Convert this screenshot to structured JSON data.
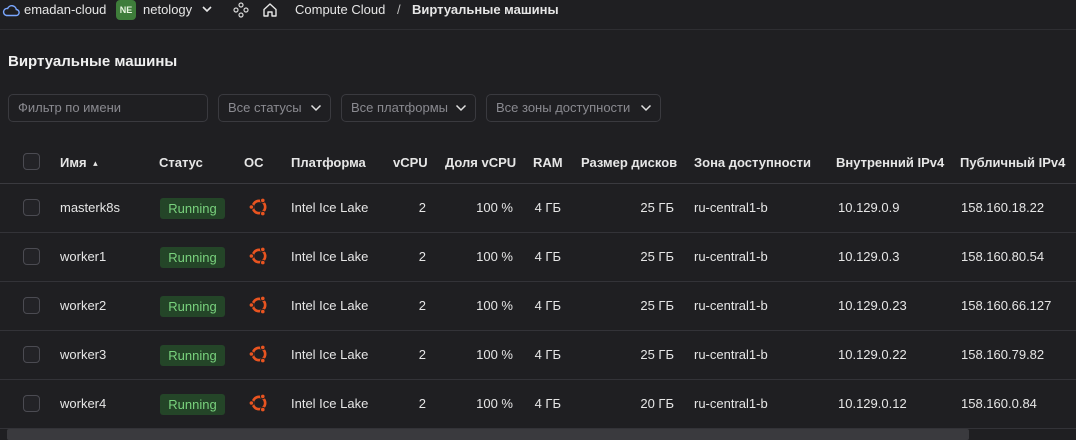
{
  "topbar": {
    "cloud_name": "emadan-cloud",
    "folder_badge": "NE",
    "folder_name": "netology",
    "breadcrumb_service": "Compute Cloud",
    "breadcrumb_separator": "/",
    "breadcrumb_current": "Виртуальные машины"
  },
  "page": {
    "title": "Виртуальные машины"
  },
  "filters": {
    "name_placeholder": "Фильтр по имени",
    "status": "Все статусы",
    "platform": "Все платформы",
    "zone": "Все зоны доступности"
  },
  "table": {
    "headers": {
      "name": "Имя",
      "sort_indicator": "▴",
      "status": "Статус",
      "os": "ОС",
      "platform": "Платформа",
      "vcpu": "vCPU",
      "vcpu_share": "Доля vCPU",
      "ram": "RAM",
      "disk": "Размер дисков",
      "zone": "Зона доступности",
      "ipv4_internal": "Внутренний IPv4",
      "ipv4_public": "Публичный IPv4"
    },
    "rows": [
      {
        "name": "masterk8s",
        "status": "Running",
        "os": "ubuntu-icon",
        "platform": "Intel Ice Lake",
        "vcpu": "2",
        "vcpu_share": "100 %",
        "ram": "4 ГБ",
        "disk": "25 ГБ",
        "zone": "ru-central1-b",
        "ipv4_internal": "10.129.0.9",
        "ipv4_public": "158.160.18.22"
      },
      {
        "name": "worker1",
        "status": "Running",
        "os": "ubuntu-icon",
        "platform": "Intel Ice Lake",
        "vcpu": "2",
        "vcpu_share": "100 %",
        "ram": "4 ГБ",
        "disk": "25 ГБ",
        "zone": "ru-central1-b",
        "ipv4_internal": "10.129.0.3",
        "ipv4_public": "158.160.80.54"
      },
      {
        "name": "worker2",
        "status": "Running",
        "os": "ubuntu-icon",
        "platform": "Intel Ice Lake",
        "vcpu": "2",
        "vcpu_share": "100 %",
        "ram": "4 ГБ",
        "disk": "25 ГБ",
        "zone": "ru-central1-b",
        "ipv4_internal": "10.129.0.23",
        "ipv4_public": "158.160.66.127"
      },
      {
        "name": "worker3",
        "status": "Running",
        "os": "ubuntu-icon",
        "platform": "Intel Ice Lake",
        "vcpu": "2",
        "vcpu_share": "100 %",
        "ram": "4 ГБ",
        "disk": "25 ГБ",
        "zone": "ru-central1-b",
        "ipv4_internal": "10.129.0.22",
        "ipv4_public": "158.160.79.82"
      },
      {
        "name": "worker4",
        "status": "Running",
        "os": "ubuntu-icon",
        "platform": "Intel Ice Lake",
        "vcpu": "2",
        "vcpu_share": "100 %",
        "ram": "4 ГБ",
        "disk": "20 ГБ",
        "zone": "ru-central1-b",
        "ipv4_internal": "10.129.0.12",
        "ipv4_public": "158.160.0.84"
      }
    ]
  },
  "colors": {
    "background": "#1f1f22",
    "running_badge_bg": "#244528",
    "running_badge_text": "#79d27d",
    "ubuntu_orange": "#e95420",
    "folder_badge_bg": "#3e7d3a"
  }
}
